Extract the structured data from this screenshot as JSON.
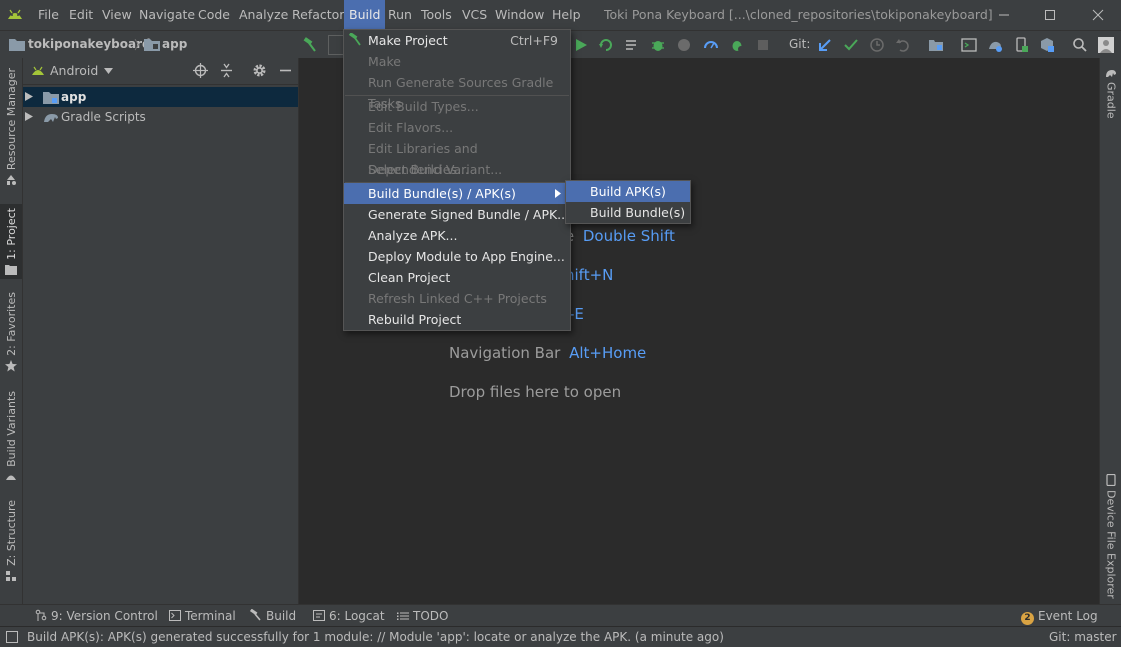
{
  "menubar": {
    "items": [
      "File",
      "Edit",
      "View",
      "Navigate",
      "Code",
      "Analyze",
      "Refactor",
      "Build",
      "Run",
      "Tools",
      "VCS",
      "Window",
      "Help"
    ],
    "window_title": "Toki Pona Keyboard [...\\cloned_repositories\\tokiponakeyboard]"
  },
  "navbar": {
    "project": "tokiponakeyboard",
    "module": "app",
    "git_label": "Git:"
  },
  "project_panel": {
    "view_selector": "Android",
    "tree": [
      {
        "label": "app",
        "icon": "folder-module-icon"
      },
      {
        "label": "Gradle Scripts",
        "icon": "gradle-icon"
      }
    ]
  },
  "left_tabs": [
    "Resource Manager",
    "1: Project",
    "2: Favorites",
    "Build Variants",
    "Z: Structure"
  ],
  "right_tabs": [
    "Gradle",
    "Device File Explorer"
  ],
  "editor_hints": {
    "search_suffix": "re",
    "search_key": "Double Shift",
    "line2_key": "hift+N",
    "line3_key": "-E",
    "nav_label": "Navigation Bar",
    "nav_key": "Alt+Home",
    "drop": "Drop files here to open"
  },
  "build_menu": {
    "items": [
      {
        "label": "Make Project",
        "shortcut": "Ctrl+F9",
        "enabled": true,
        "icon": "hammer-icon"
      },
      {
        "label": "Make",
        "enabled": false
      },
      {
        "label": "Run Generate Sources Gradle Tasks",
        "enabled": false
      },
      {
        "label": "Edit Build Types...",
        "enabled": false
      },
      {
        "label": "Edit Flavors...",
        "enabled": false
      },
      {
        "label": "Edit Libraries and Dependencies...",
        "enabled": false
      },
      {
        "label": "Select Build Variant...",
        "enabled": false
      },
      {
        "label": "Build Bundle(s) / APK(s)",
        "enabled": true,
        "submenu": true
      },
      {
        "label": "Generate Signed Bundle / APK...",
        "enabled": true
      },
      {
        "label": "Analyze APK...",
        "enabled": true
      },
      {
        "label": "Deploy Module to App Engine...",
        "enabled": true
      },
      {
        "label": "Clean Project",
        "enabled": true
      },
      {
        "label": "Refresh Linked C++ Projects",
        "enabled": false
      },
      {
        "label": "Rebuild Project",
        "enabled": true
      }
    ]
  },
  "sub_menu": {
    "items": [
      "Build APK(s)",
      "Build Bundle(s)"
    ]
  },
  "bottom_tools": [
    {
      "label": "9: Version Control",
      "icon": "version-control-icon"
    },
    {
      "label": "Terminal",
      "icon": "terminal-icon"
    },
    {
      "label": "Build",
      "icon": "hammer-icon"
    },
    {
      "label": "6: Logcat",
      "icon": "logcat-icon"
    },
    {
      "label": "TODO",
      "icon": "todo-icon"
    }
  ],
  "event_log": {
    "label": "Event Log",
    "count": "2"
  },
  "status": {
    "message": "Build APK(s): APK(s) generated successfully for 1 module: // Module 'app': locate or analyze the APK. (a minute ago)",
    "git_branch": "Git: master"
  },
  "colors": {
    "accent": "#4b6eaf",
    "link": "#589df6",
    "panel": "#3c3f41",
    "editor": "#2b2b2b"
  }
}
